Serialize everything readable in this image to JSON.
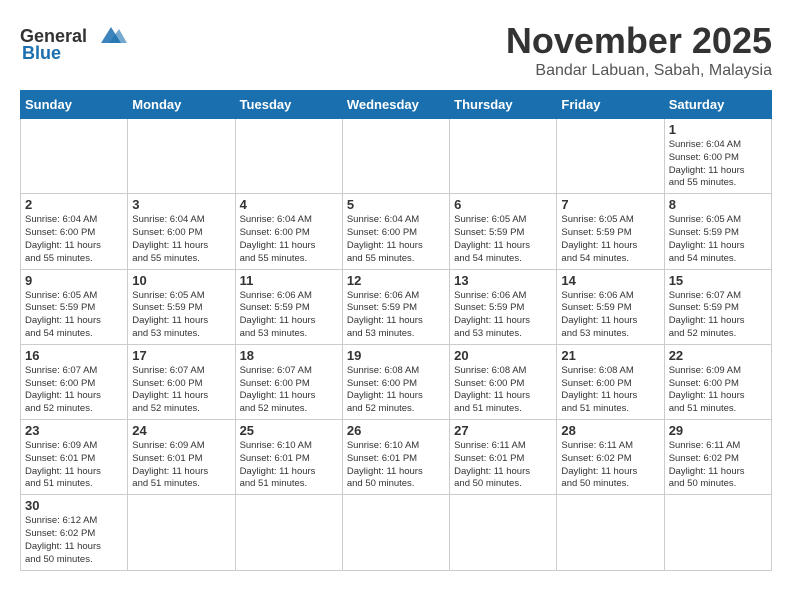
{
  "header": {
    "logo_general": "General",
    "logo_blue": "Blue",
    "month_title": "November 2025",
    "location": "Bandar Labuan, Sabah, Malaysia"
  },
  "weekdays": [
    "Sunday",
    "Monday",
    "Tuesday",
    "Wednesday",
    "Thursday",
    "Friday",
    "Saturday"
  ],
  "weeks": [
    [
      {
        "day": "",
        "info": ""
      },
      {
        "day": "",
        "info": ""
      },
      {
        "day": "",
        "info": ""
      },
      {
        "day": "",
        "info": ""
      },
      {
        "day": "",
        "info": ""
      },
      {
        "day": "",
        "info": ""
      },
      {
        "day": "1",
        "info": "Sunrise: 6:04 AM\nSunset: 6:00 PM\nDaylight: 11 hours\nand 55 minutes."
      }
    ],
    [
      {
        "day": "2",
        "info": "Sunrise: 6:04 AM\nSunset: 6:00 PM\nDaylight: 11 hours\nand 55 minutes."
      },
      {
        "day": "3",
        "info": "Sunrise: 6:04 AM\nSunset: 6:00 PM\nDaylight: 11 hours\nand 55 minutes."
      },
      {
        "day": "4",
        "info": "Sunrise: 6:04 AM\nSunset: 6:00 PM\nDaylight: 11 hours\nand 55 minutes."
      },
      {
        "day": "5",
        "info": "Sunrise: 6:04 AM\nSunset: 6:00 PM\nDaylight: 11 hours\nand 55 minutes."
      },
      {
        "day": "6",
        "info": "Sunrise: 6:05 AM\nSunset: 5:59 PM\nDaylight: 11 hours\nand 54 minutes."
      },
      {
        "day": "7",
        "info": "Sunrise: 6:05 AM\nSunset: 5:59 PM\nDaylight: 11 hours\nand 54 minutes."
      },
      {
        "day": "8",
        "info": "Sunrise: 6:05 AM\nSunset: 5:59 PM\nDaylight: 11 hours\nand 54 minutes."
      }
    ],
    [
      {
        "day": "9",
        "info": "Sunrise: 6:05 AM\nSunset: 5:59 PM\nDaylight: 11 hours\nand 54 minutes."
      },
      {
        "day": "10",
        "info": "Sunrise: 6:05 AM\nSunset: 5:59 PM\nDaylight: 11 hours\nand 53 minutes."
      },
      {
        "day": "11",
        "info": "Sunrise: 6:06 AM\nSunset: 5:59 PM\nDaylight: 11 hours\nand 53 minutes."
      },
      {
        "day": "12",
        "info": "Sunrise: 6:06 AM\nSunset: 5:59 PM\nDaylight: 11 hours\nand 53 minutes."
      },
      {
        "day": "13",
        "info": "Sunrise: 6:06 AM\nSunset: 5:59 PM\nDaylight: 11 hours\nand 53 minutes."
      },
      {
        "day": "14",
        "info": "Sunrise: 6:06 AM\nSunset: 5:59 PM\nDaylight: 11 hours\nand 53 minutes."
      },
      {
        "day": "15",
        "info": "Sunrise: 6:07 AM\nSunset: 5:59 PM\nDaylight: 11 hours\nand 52 minutes."
      }
    ],
    [
      {
        "day": "16",
        "info": "Sunrise: 6:07 AM\nSunset: 6:00 PM\nDaylight: 11 hours\nand 52 minutes."
      },
      {
        "day": "17",
        "info": "Sunrise: 6:07 AM\nSunset: 6:00 PM\nDaylight: 11 hours\nand 52 minutes."
      },
      {
        "day": "18",
        "info": "Sunrise: 6:07 AM\nSunset: 6:00 PM\nDaylight: 11 hours\nand 52 minutes."
      },
      {
        "day": "19",
        "info": "Sunrise: 6:08 AM\nSunset: 6:00 PM\nDaylight: 11 hours\nand 52 minutes."
      },
      {
        "day": "20",
        "info": "Sunrise: 6:08 AM\nSunset: 6:00 PM\nDaylight: 11 hours\nand 51 minutes."
      },
      {
        "day": "21",
        "info": "Sunrise: 6:08 AM\nSunset: 6:00 PM\nDaylight: 11 hours\nand 51 minutes."
      },
      {
        "day": "22",
        "info": "Sunrise: 6:09 AM\nSunset: 6:00 PM\nDaylight: 11 hours\nand 51 minutes."
      }
    ],
    [
      {
        "day": "23",
        "info": "Sunrise: 6:09 AM\nSunset: 6:01 PM\nDaylight: 11 hours\nand 51 minutes."
      },
      {
        "day": "24",
        "info": "Sunrise: 6:09 AM\nSunset: 6:01 PM\nDaylight: 11 hours\nand 51 minutes."
      },
      {
        "day": "25",
        "info": "Sunrise: 6:10 AM\nSunset: 6:01 PM\nDaylight: 11 hours\nand 51 minutes."
      },
      {
        "day": "26",
        "info": "Sunrise: 6:10 AM\nSunset: 6:01 PM\nDaylight: 11 hours\nand 50 minutes."
      },
      {
        "day": "27",
        "info": "Sunrise: 6:11 AM\nSunset: 6:01 PM\nDaylight: 11 hours\nand 50 minutes."
      },
      {
        "day": "28",
        "info": "Sunrise: 6:11 AM\nSunset: 6:02 PM\nDaylight: 11 hours\nand 50 minutes."
      },
      {
        "day": "29",
        "info": "Sunrise: 6:11 AM\nSunset: 6:02 PM\nDaylight: 11 hours\nand 50 minutes."
      }
    ],
    [
      {
        "day": "30",
        "info": "Sunrise: 6:12 AM\nSunset: 6:02 PM\nDaylight: 11 hours\nand 50 minutes."
      },
      {
        "day": "",
        "info": ""
      },
      {
        "day": "",
        "info": ""
      },
      {
        "day": "",
        "info": ""
      },
      {
        "day": "",
        "info": ""
      },
      {
        "day": "",
        "info": ""
      },
      {
        "day": "",
        "info": ""
      }
    ]
  ]
}
